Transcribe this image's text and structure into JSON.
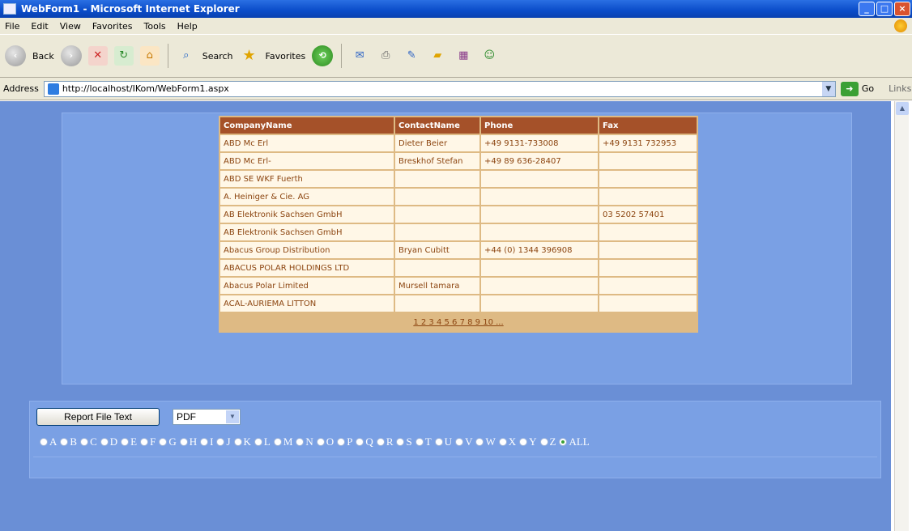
{
  "window": {
    "title": "WebForm1 - Microsoft Internet Explorer"
  },
  "menu": [
    "File",
    "Edit",
    "View",
    "Favorites",
    "Tools",
    "Help"
  ],
  "toolbar": {
    "back_label": "Back",
    "search_label": "Search",
    "favorites_label": "Favorites"
  },
  "address": {
    "label": "Address",
    "url": "http://localhost/IKom/WebForm1.aspx",
    "go_label": "Go",
    "links_label": "Links"
  },
  "grid": {
    "headers": [
      "CompanyName",
      "ContactName",
      "Phone",
      "Fax"
    ],
    "rows": [
      [
        "ABD Mc Erl",
        "Dieter Beier",
        "+49 9131-733008",
        "+49 9131 732953"
      ],
      [
        "ABD Mc Erl-",
        "Breskhof Stefan",
        "+49 89 636-28407",
        ""
      ],
      [
        "ABD SE WKF Fuerth",
        "",
        "",
        ""
      ],
      [
        "A. Heiniger & Cie. AG",
        "",
        "",
        ""
      ],
      [
        "AB Elektronik Sachsen GmbH",
        "",
        "",
        "03 5202 57401"
      ],
      [
        "AB Elektronik Sachsen GmbH",
        "",
        "",
        ""
      ],
      [
        "Abacus Group Distribution",
        "Bryan Cubitt",
        "+44 (0) 1344 396908",
        ""
      ],
      [
        "ABACUS POLAR HOLDINGS LTD",
        "",
        "",
        ""
      ],
      [
        "Abacus Polar Limited",
        "Mursell tamara",
        "",
        ""
      ],
      [
        "ACAL-AURIEMA LITTON",
        "",
        "",
        ""
      ]
    ],
    "pager": "1 2 3 4 5 6 7 8 9 10 ..."
  },
  "report": {
    "button_label": "Report File Text",
    "format_value": "PDF"
  },
  "letters": [
    "A",
    "B",
    "C",
    "D",
    "E",
    "F",
    "G",
    "H",
    "I",
    "J",
    "K",
    "L",
    "M",
    "N",
    "O",
    "P",
    "Q",
    "R",
    "S",
    "T",
    "U",
    "V",
    "W",
    "X",
    "Y",
    "Z",
    "ALL"
  ],
  "selected_letter": "ALL"
}
